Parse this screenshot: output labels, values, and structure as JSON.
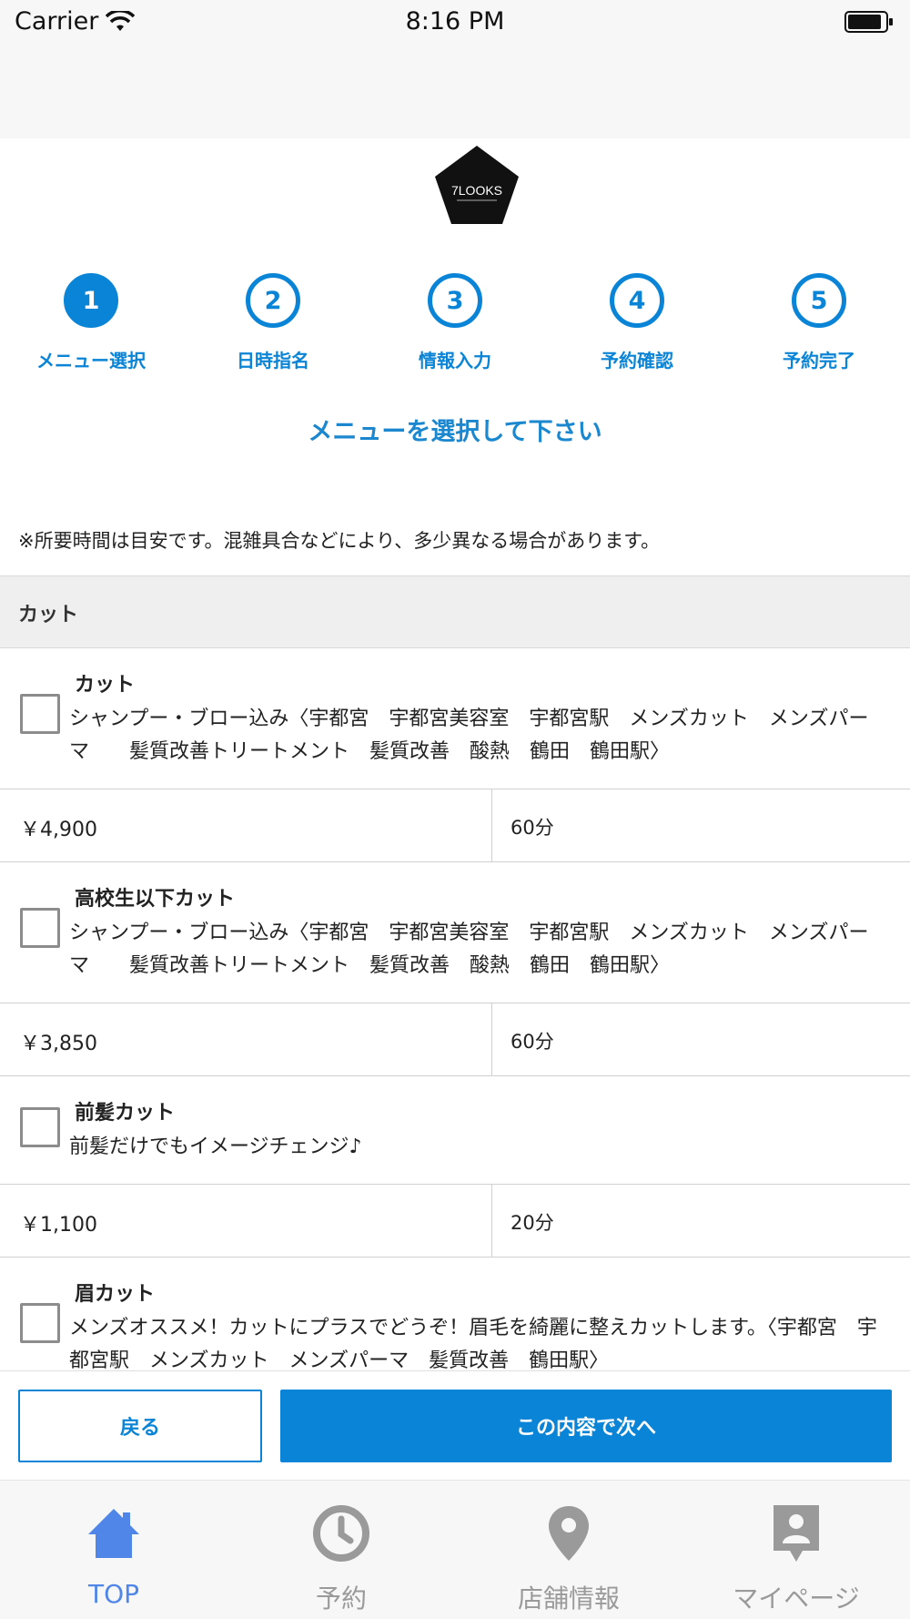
{
  "status_bar": {
    "carrier": "Carrier",
    "time": "8:16 PM"
  },
  "logo": {
    "text": "7LOOKS",
    "icon": "pentagon-logo"
  },
  "steps": [
    {
      "number": "1",
      "label": "メニュー選択",
      "active": true
    },
    {
      "number": "2",
      "label": "日時指名",
      "active": false
    },
    {
      "number": "3",
      "label": "情報入力",
      "active": false
    },
    {
      "number": "4",
      "label": "予約確認",
      "active": false
    },
    {
      "number": "5",
      "label": "予約完了",
      "active": false
    }
  ],
  "section_title": "メニューを選択して下さい",
  "note": "※所要時間は目安です。混雑具合などにより、多少異なる場合があります。",
  "category": "カット",
  "menu_items": [
    {
      "name": "カット",
      "description": "シャンプー・ブロー込み〈宇都宮　宇都宮美容室　宇都宮駅　メンズカット　メンズパーマ　　髪質改善トリートメント　髪質改善　酸熱　鶴田　鶴田駅〉",
      "price": "￥4,900",
      "duration": "60分"
    },
    {
      "name": "高校生以下カット",
      "description": "シャンプー・ブロー込み〈宇都宮　宇都宮美容室　宇都宮駅　メンズカット　メンズパーマ　　髪質改善トリートメント　髪質改善　酸熱　鶴田　鶴田駅〉",
      "price": "￥3,850",
      "duration": "60分"
    },
    {
      "name": "前髪カット",
      "description": "前髪だけでもイメージチェンジ♪",
      "price": "￥1,100",
      "duration": "20分"
    },
    {
      "name": "眉カット",
      "description": "メンズオススメ！カットにプラスでどうぞ！眉毛を綺麗に整えカットします。〈宇都宮　宇都宮駅　メンズカット　メンズパーマ　髪質改善　鶴田駅〉",
      "price": "",
      "duration": ""
    }
  ],
  "actions": {
    "back_label": "戻る",
    "next_label": "この内容で次へ"
  },
  "tabs": [
    {
      "label": "TOP",
      "icon": "home-icon",
      "active": true
    },
    {
      "label": "予約",
      "icon": "clock-icon",
      "active": false
    },
    {
      "label": "店舗情報",
      "icon": "map-pin-icon",
      "active": false
    },
    {
      "label": "マイページ",
      "icon": "profile-icon",
      "active": false
    }
  ],
  "colors": {
    "accent": "#0a84d6",
    "tab_active": "#4f86e8",
    "tab_inactive": "#9a9a9a"
  }
}
